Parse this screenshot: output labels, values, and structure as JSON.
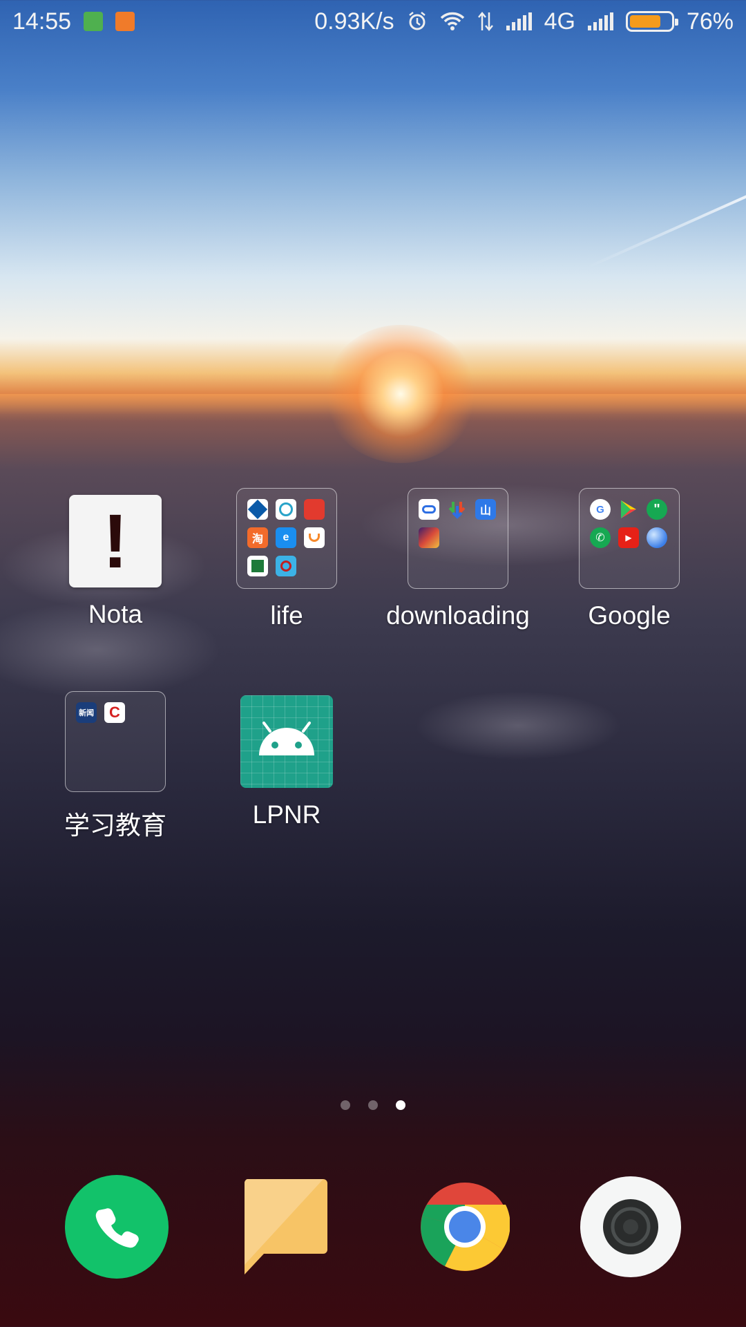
{
  "status_bar": {
    "time": "14:55",
    "network_speed": "0.93K/s",
    "network_type": "4G",
    "battery_percent": "76%",
    "battery_level": 0.76,
    "icons": [
      "android-notification-icon",
      "video-notification-icon",
      "alarm-icon",
      "wifi-icon",
      "data-transfer-icon",
      "signal-icon",
      "signal-icon",
      "battery-icon"
    ]
  },
  "home": {
    "apps": [
      {
        "label": "Nota",
        "type": "app",
        "icon": "exclamation-icon"
      },
      {
        "label": "life",
        "type": "folder"
      },
      {
        "label": "downloading",
        "type": "folder"
      },
      {
        "label": "Google",
        "type": "folder"
      },
      {
        "label": "学习教育",
        "type": "folder"
      },
      {
        "label": "LPNR",
        "type": "app",
        "icon": "android-icon"
      }
    ]
  },
  "pages": {
    "count": 3,
    "current": 3
  },
  "dock": {
    "items": [
      "phone-icon",
      "messages-icon",
      "chrome-icon",
      "camera-icon"
    ]
  },
  "colors": {
    "phone_green": "#12c26a",
    "battery_orange": "#f59b1c",
    "lpnr_teal": "#1fa18a",
    "messages_yellow": "#f7c466"
  }
}
